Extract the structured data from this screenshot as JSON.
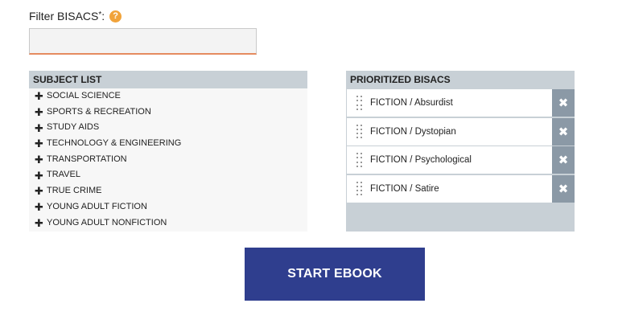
{
  "filter": {
    "label": "Filter BISACS",
    "required_mark": "*",
    "colon": ":",
    "help_icon": "question-icon",
    "value": "",
    "placeholder": ""
  },
  "subject_list": {
    "header": "SUBJECT LIST",
    "expand_icon": "plus-icon",
    "items": [
      {
        "label": "SOCIAL SCIENCE"
      },
      {
        "label": "SPORTS & RECREATION"
      },
      {
        "label": "STUDY AIDS"
      },
      {
        "label": "TECHNOLOGY & ENGINEERING"
      },
      {
        "label": "TRANSPORTATION"
      },
      {
        "label": "TRAVEL"
      },
      {
        "label": "TRUE CRIME"
      },
      {
        "label": "YOUNG ADULT FICTION"
      },
      {
        "label": "YOUNG ADULT NONFICTION"
      }
    ]
  },
  "prioritized": {
    "header": "PRIORITIZED BISACS",
    "drag_icon": "drag-handle-icon",
    "remove_icon": "close-icon",
    "items": [
      {
        "label": "FICTION / Absurdist"
      },
      {
        "label": "FICTION / Dystopian"
      },
      {
        "label": "FICTION / Psychological"
      },
      {
        "label": "FICTION / Satire"
      }
    ]
  },
  "start_button": {
    "label": "START EBOOK"
  },
  "colors": {
    "accent": "#2f3e8e",
    "panel_header": "#c8d0d6",
    "remove_button": "#8b99a6",
    "help_icon": "#f1a33a",
    "input_underline": "#e58b5f"
  }
}
